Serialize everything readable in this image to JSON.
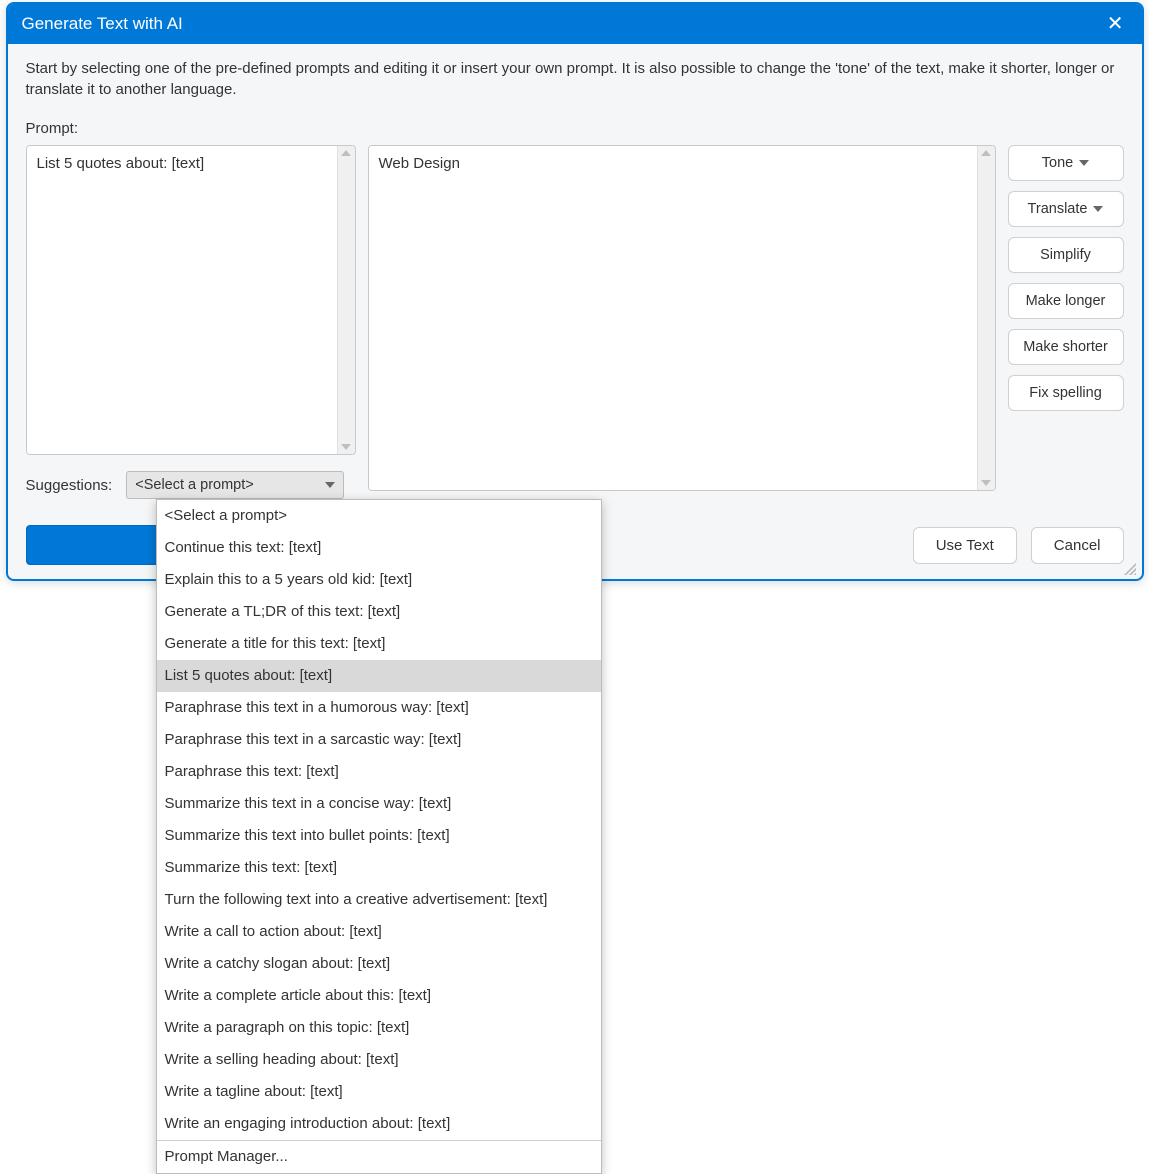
{
  "titlebar": {
    "title": "Generate Text with AI"
  },
  "intro": "Start by selecting one of the pre-defined prompts and editing it or insert your own prompt. It is also possible to change the 'tone' of the text, make it shorter, longer or translate it to another language.",
  "prompt_label": "Prompt:",
  "prompt_textarea": "List 5 quotes about: [text]",
  "output_textarea": "Web Design",
  "side_buttons": {
    "tone": "Tone",
    "translate": "Translate",
    "simplify": "Simplify",
    "make_longer": "Make longer",
    "make_shorter": "Make shorter",
    "fix_spelling": "Fix spelling"
  },
  "suggestions_label": "Suggestions:",
  "combo_value": "<Select a prompt>",
  "dropdown": {
    "selected_index": 5,
    "items": [
      "<Select a prompt>",
      "Continue this text: [text]",
      "Explain this to a 5 years old kid: [text]",
      "Generate a TL;DR of this text: [text]",
      "Generate a title for this text: [text]",
      "List 5 quotes about: [text]",
      "Paraphrase this text in a humorous way: [text]",
      "Paraphrase this text in a sarcastic way: [text]",
      "Paraphrase this text: [text]",
      "Summarize this text in a concise way: [text]",
      "Summarize this text into bullet points: [text]",
      "Summarize this text: [text]",
      "Turn the following text into a creative advertisement: [text]",
      "Write a call to action about: [text]",
      "Write a catchy slogan about: [text]",
      "Write a complete article about this: [text]",
      "Write a paragraph on this topic: [text]",
      "Write a selling heading about: [text]",
      "Write a tagline about: [text]",
      "Write an engaging introduction about: [text]"
    ],
    "footer_item": "Prompt Manager..."
  },
  "footer": {
    "use_text": "Use Text",
    "cancel": "Cancel"
  }
}
